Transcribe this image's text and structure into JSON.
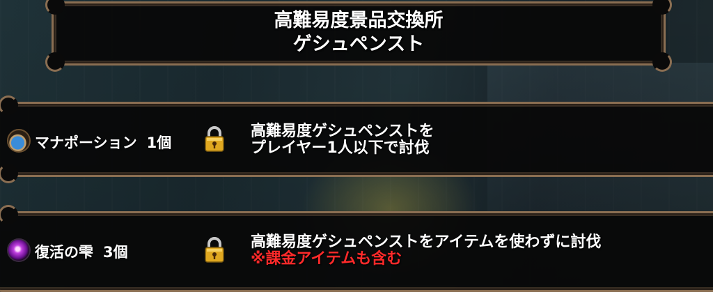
{
  "header": {
    "title_line1": "高難易度景品交換所",
    "title_line2": "ゲシュペンスト"
  },
  "rewards": [
    {
      "item_icon": "mana-potion-icon",
      "item_name": "マナポーション",
      "quantity": "1個",
      "status_icon": "padlock-icon",
      "condition_line1": "高難易度ゲシュペンストを",
      "condition_line2": "プレイヤー1人以下で討伐"
    },
    {
      "item_icon": "revival-drop-icon",
      "item_name": "復活の雫",
      "quantity": "3個",
      "status_icon": "padlock-icon",
      "condition_line1": "高難易度ゲシュペンストをアイテムを使わずに討伐",
      "condition_note": "※課金アイテムも含む"
    }
  ],
  "colors": {
    "frame": "#8a6e52",
    "panel": "#080808",
    "text": "#ffffff",
    "note": "#ff2a2a"
  }
}
